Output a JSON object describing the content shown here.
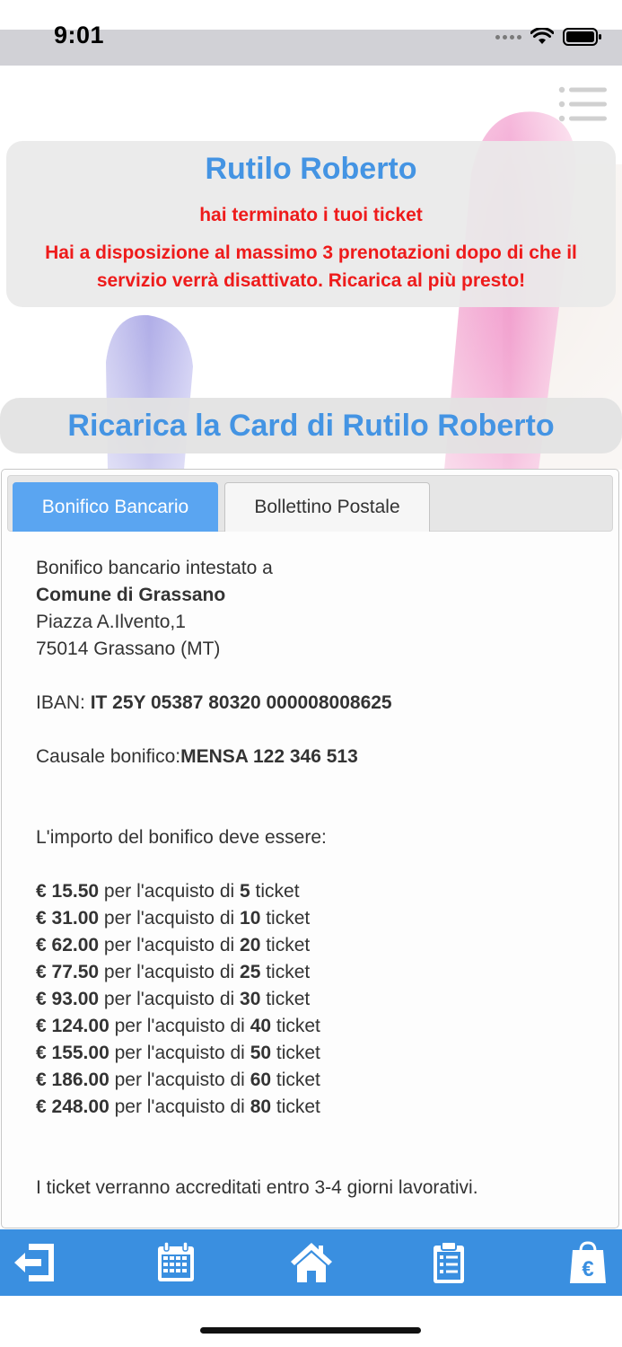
{
  "status": {
    "time": "9:01"
  },
  "header": {
    "menu_icon": "hamburger-menu-icon"
  },
  "notice": {
    "name": "Rutilo Roberto",
    "line1": "hai terminato i tuoi ticket",
    "line2": "Hai a disposizione al massimo 3 prenotazioni dopo di che il servizio verrà disattivato. Ricarica al più presto!"
  },
  "recharge": {
    "title": "Ricarica la Card di Rutilo Roberto",
    "tabs": [
      {
        "label": "Bonifico Bancario",
        "active": true
      },
      {
        "label": "Bollettino Postale",
        "active": false
      }
    ],
    "bank": {
      "intro": "Bonifico bancario intestato a",
      "recipient": "Comune di Grassano",
      "address1": "Piazza A.Ilvento,1",
      "address2": "75014 Grassano (MT)",
      "iban_label": "IBAN: ",
      "iban_value": "IT 25Y 05387 80320 000008008625",
      "causale_label": "Causale bonifico:",
      "causale_value": "MENSA 122 346 513",
      "amount_intro": "L'importo del bonifico deve essere:",
      "prices": [
        {
          "amount": "€ 15.50",
          "mid": " per l'acquisto di ",
          "qty": "5",
          "suffix": " ticket"
        },
        {
          "amount": "€ 31.00",
          "mid": " per l'acquisto di ",
          "qty": "10",
          "suffix": " ticket"
        },
        {
          "amount": "€ 62.00",
          "mid": " per l'acquisto di ",
          "qty": "20",
          "suffix": " ticket"
        },
        {
          "amount": "€ 77.50",
          "mid": " per l'acquisto di ",
          "qty": "25",
          "suffix": " ticket"
        },
        {
          "amount": "€ 93.00",
          "mid": " per l'acquisto di ",
          "qty": "30",
          "suffix": " ticket"
        },
        {
          "amount": "€ 124.00",
          "mid": " per l'acquisto di ",
          "qty": "40",
          "suffix": " ticket"
        },
        {
          "amount": "€ 155.00",
          "mid": " per l'acquisto di ",
          "qty": "50",
          "suffix": " ticket"
        },
        {
          "amount": "€ 186.00",
          "mid": " per l'acquisto di ",
          "qty": "60",
          "suffix": " ticket"
        },
        {
          "amount": "€ 248.00",
          "mid": " per l'acquisto di ",
          "qty": "80",
          "suffix": " ticket"
        }
      ],
      "footer": "I ticket verranno accreditati entro 3-4 giorni lavorativi."
    }
  },
  "bottom_nav": {
    "items": [
      {
        "icon": "logout-icon"
      },
      {
        "icon": "calendar-icon"
      },
      {
        "icon": "home-icon"
      },
      {
        "icon": "clipboard-list-icon"
      },
      {
        "icon": "euro-bag-icon"
      }
    ]
  },
  "colors": {
    "accent": "#4494e3",
    "alert": "#ee1b1b",
    "nav_bg": "#3a8fe0",
    "tab_active": "#5aa5f1"
  }
}
